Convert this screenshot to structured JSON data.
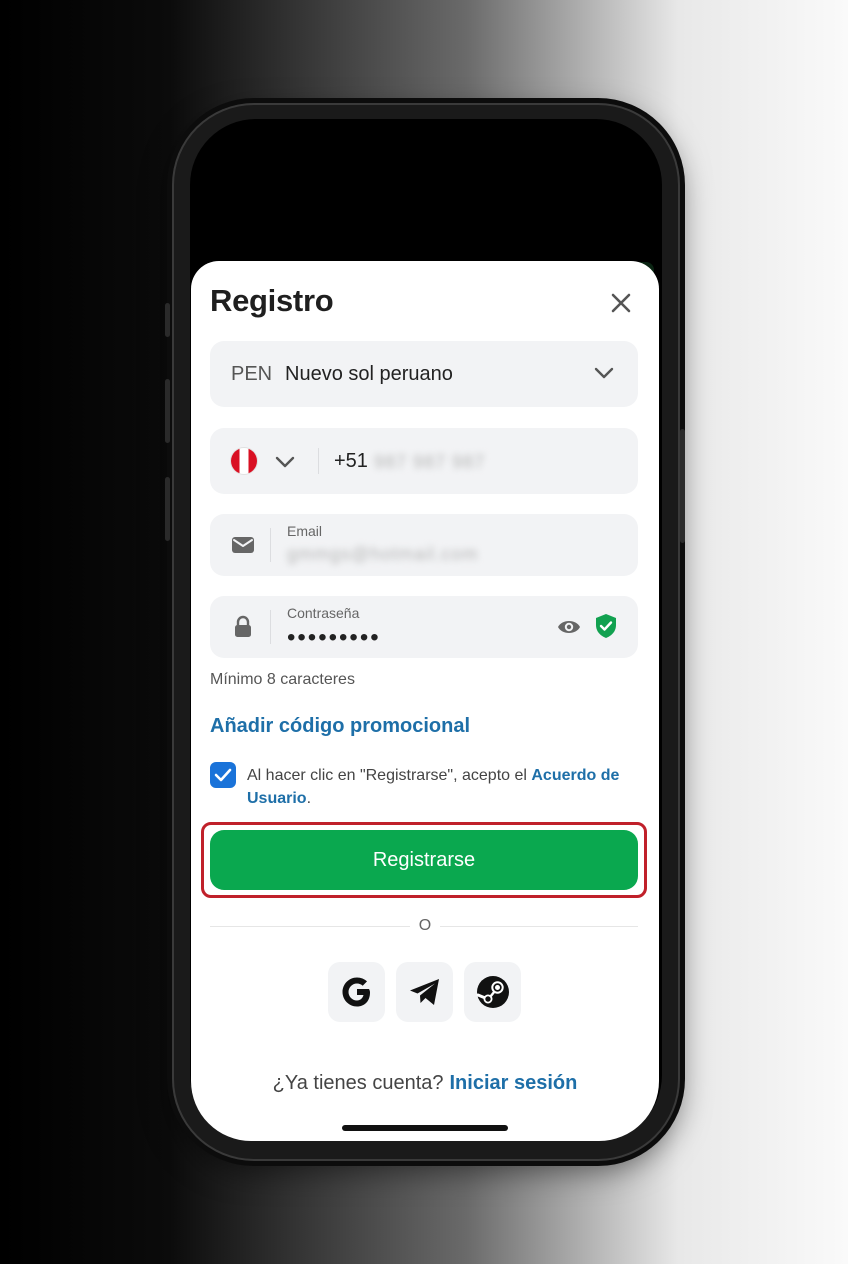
{
  "modal": {
    "title": "Registro"
  },
  "currency": {
    "code": "PEN",
    "name": "Nuevo sol peruano"
  },
  "phone": {
    "dial_code": "+51",
    "number_blurred": "987 987 987"
  },
  "email": {
    "label": "Email",
    "value_blurred": "gmmgs@hotmail.com"
  },
  "password": {
    "label": "Contraseña",
    "masked_value": "•••••••••",
    "hint": "Mínimo 8 caracteres"
  },
  "promo": {
    "link_text": "Añadir código promocional"
  },
  "terms": {
    "checked": true,
    "text": "Al hacer clic en \"Registrarse\", acepto el ",
    "link_text": "Acuerdo de Usuario",
    "suffix": "."
  },
  "actions": {
    "register_label": "Registrarse",
    "or_label": "O"
  },
  "social": [
    "google-icon",
    "telegram-icon",
    "steam-icon"
  ],
  "login": {
    "prompt": "¿Ya tienes cuenta?",
    "link_text": "Iniciar sesión"
  },
  "colors": {
    "accent_green": "#0aa84f",
    "link_blue": "#1e6fa8",
    "checkbox_blue": "#1a73d9",
    "highlight_red": "#c0202a",
    "shield_green": "#12a150"
  }
}
